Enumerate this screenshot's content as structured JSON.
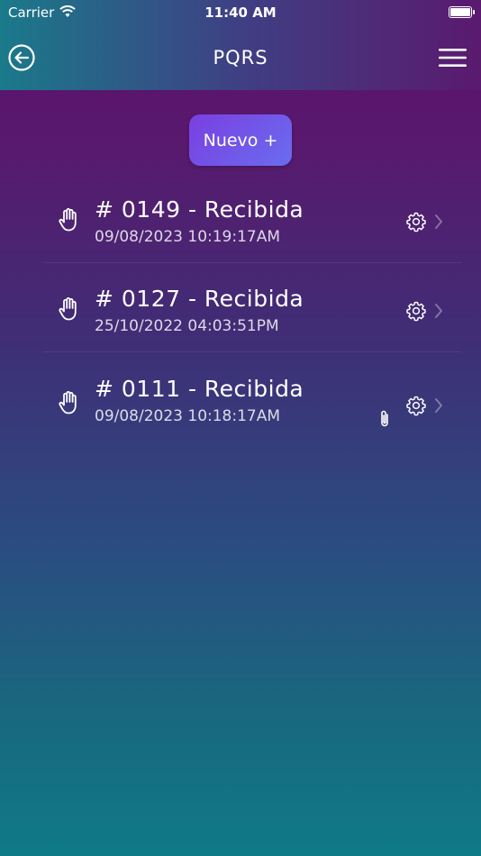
{
  "status_bar": {
    "carrier": "Carrier",
    "time": "11:40 AM"
  },
  "header": {
    "title": "PQRS"
  },
  "new_button": {
    "label": "Nuevo +"
  },
  "items": [
    {
      "title": "# 0149 - Recibida",
      "date": "09/08/2023 10:19:17AM",
      "has_attachment": false
    },
    {
      "title": "# 0127 - Recibida",
      "date": "25/10/2022 04:03:51PM",
      "has_attachment": false
    },
    {
      "title": "# 0111 - Recibida",
      "date": "09/08/2023 10:18:17AM",
      "has_attachment": true
    }
  ],
  "icons": {
    "back": "back-arrow-circle-icon",
    "menu": "hamburger-menu-icon",
    "item": "hand-icon",
    "settings": "gear-icon",
    "disclosure": "chevron-right-icon",
    "attachment": "paperclip-icon"
  },
  "colors": {
    "accent_button": "#7a3fe0",
    "header_start": "#1a7a8a",
    "header_end": "#5a1a6e"
  }
}
